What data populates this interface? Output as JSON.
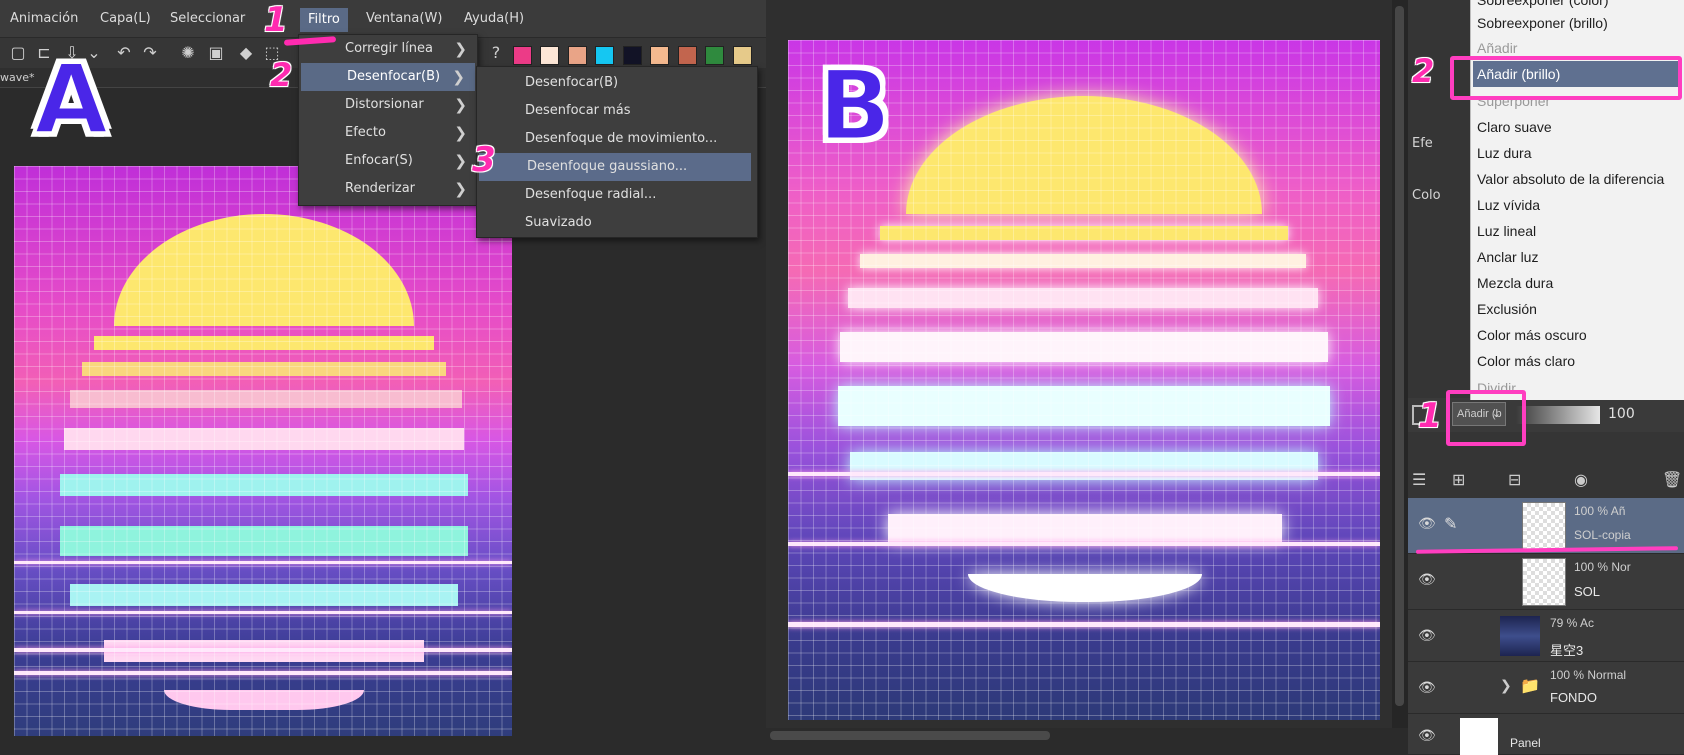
{
  "panel_a": {
    "label": "A",
    "menubar": [
      "Animación",
      "Capa(L)",
      "Seleccionar",
      "Filtro",
      "Ventana(W)",
      "Ayuda(H)"
    ],
    "tab_label": "wave*",
    "swatch_colors": [
      "#ec3b87",
      "#fde6d6",
      "#e9a487",
      "#15c7f2",
      "#121326",
      "#f4b98f",
      "#c2654e",
      "#2f8a3e",
      "#e6ca8a"
    ],
    "filter_menu": [
      {
        "label": "Corregir línea",
        "arrow": "❯"
      },
      {
        "label": "Desenfocar(B)",
        "arrow": "❯"
      },
      {
        "label": "Distorsionar",
        "arrow": "❯"
      },
      {
        "label": "Efecto",
        "arrow": "❯"
      },
      {
        "label": "Enfocar(S)",
        "arrow": "❯"
      },
      {
        "label": "Renderizar",
        "arrow": "❯"
      }
    ],
    "blur_submenu": [
      "Desenfocar(B)",
      "Desenfocar más",
      "Desenfoque de movimiento...",
      "Desenfoque gaussiano...",
      "Desenfoque radial...",
      "Suavizado"
    ],
    "step_numbers": [
      "1",
      "2",
      "3"
    ]
  },
  "panel_b": {
    "label": "B",
    "blend_modes": [
      "Sobreexponer (color)",
      "Sobreexponer (brillo)",
      "Añadir",
      "Añadir (brillo)",
      "Superponer",
      "Claro suave",
      "Luz dura",
      "Valor absoluto de la diferencia",
      "Luz vívida",
      "Luz lineal",
      "Anclar luz",
      "Mezcla dura",
      "Exclusión",
      "Color más oscuro",
      "Color más claro",
      "Dividir"
    ],
    "side_labels": [
      "Efe",
      "Colo"
    ],
    "blend_dropdown": "Añadir (b",
    "opacity_value": "100",
    "step_numbers": [
      "2",
      "1"
    ],
    "layers": [
      {
        "opacity_mode": "100 % Añ",
        "name": "SOL-copia"
      },
      {
        "opacity_mode": "100 % Nor",
        "name": "SOL"
      },
      {
        "opacity_mode": "79 % Ac",
        "name": "星空3"
      },
      {
        "opacity_mode": "100 % Normal",
        "name": "FONDO"
      },
      {
        "opacity_mode": "",
        "name": "Panel"
      }
    ]
  },
  "icons": {
    "eye": "👁",
    "pencil": "✎",
    "folder": "📁",
    "chevron_right": "❯",
    "chevron_down": "⌄"
  }
}
